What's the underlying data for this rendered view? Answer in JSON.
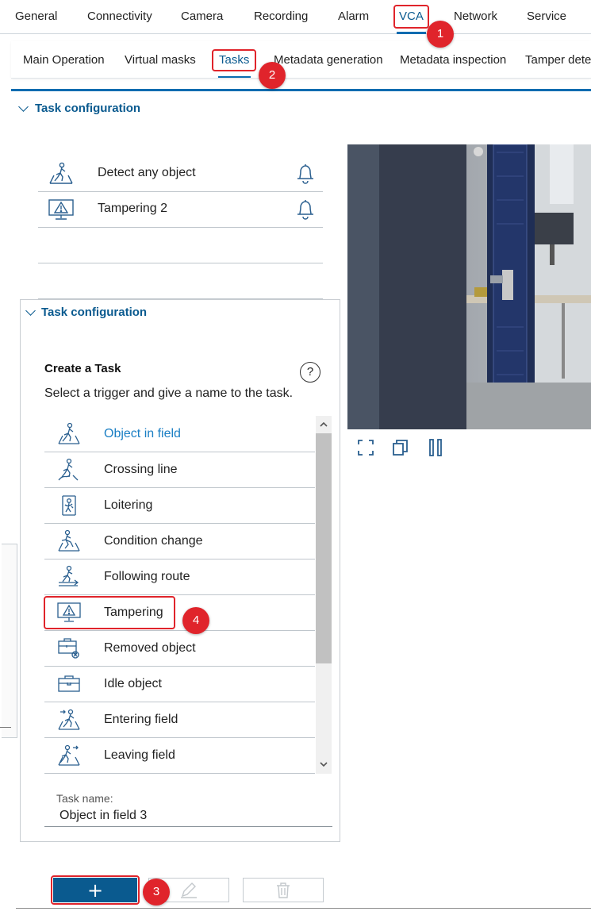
{
  "top_tabs": [
    "General",
    "Connectivity",
    "Camera",
    "Recording",
    "Alarm",
    "VCA",
    "Network",
    "Service"
  ],
  "sub_tabs": [
    "Main Operation",
    "Virtual masks",
    "Tasks",
    "Metadata generation",
    "Metadata inspection",
    "Tamper dete"
  ],
  "section_title": "Task configuration",
  "tasks": [
    {
      "label": "Detect any object",
      "icon": "object-in-field-icon"
    },
    {
      "label": "Tampering 2",
      "icon": "tampering-icon"
    }
  ],
  "panel": {
    "title": "Task configuration",
    "create_heading": "Create a Task",
    "instruction": "Select a trigger and give a name to the task.",
    "help": "?",
    "triggers": [
      {
        "label": "Object in field",
        "icon": "object-in-field-icon",
        "selected": true
      },
      {
        "label": "Crossing line",
        "icon": "crossing-line-icon"
      },
      {
        "label": "Loitering",
        "icon": "loitering-icon"
      },
      {
        "label": "Condition change",
        "icon": "condition-change-icon"
      },
      {
        "label": "Following route",
        "icon": "following-route-icon"
      },
      {
        "label": "Tampering",
        "icon": "tampering-icon"
      },
      {
        "label": "Removed object",
        "icon": "removed-object-icon"
      },
      {
        "label": "Idle object",
        "icon": "idle-object-icon"
      },
      {
        "label": "Entering field",
        "icon": "entering-field-icon"
      },
      {
        "label": "Leaving field",
        "icon": "leaving-field-icon"
      }
    ],
    "task_name_label": "Task name:",
    "task_name_value": "Object in field 3"
  },
  "buttons": {
    "add": "+"
  },
  "annotations": [
    "1",
    "2",
    "3",
    "4"
  ],
  "colors": {
    "accent": "#0a5a8f",
    "selected_text": "#1b7fc4",
    "annotation": "#e0242b"
  }
}
